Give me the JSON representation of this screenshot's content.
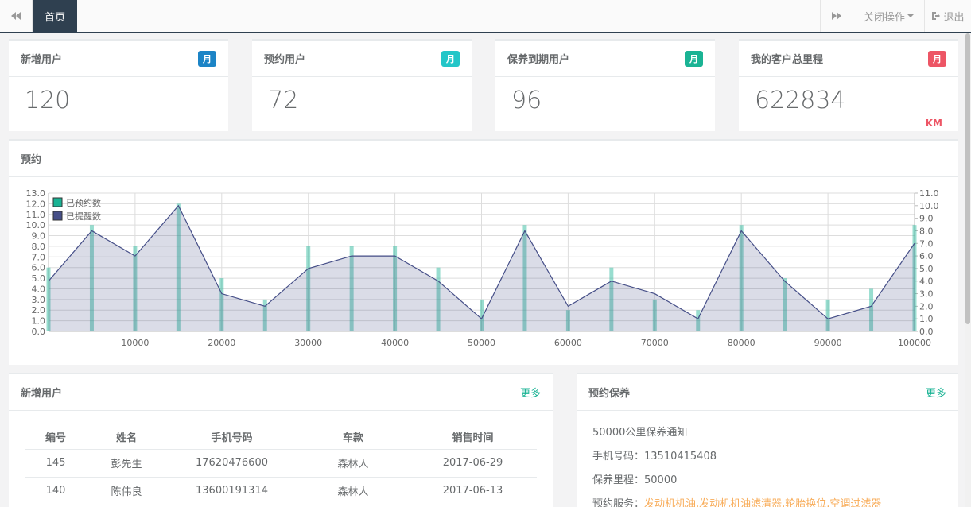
{
  "topbar": {
    "home_tab": "首页",
    "close_ops": "关闭操作",
    "logout": "退出"
  },
  "stats": [
    {
      "title": "新增用户",
      "badge": "月",
      "badge_color": "#1c84c6",
      "value": "120"
    },
    {
      "title": "预约用户",
      "badge": "月",
      "badge_color": "#23c6c8",
      "value": "72"
    },
    {
      "title": "保养到期用户",
      "badge": "月",
      "badge_color": "#1ab394",
      "value": "96"
    },
    {
      "title": "我的客户总里程",
      "badge": "月",
      "badge_color": "#ed5565",
      "value": "622834",
      "unit": "KM"
    }
  ],
  "booking_panel": {
    "title": "预约"
  },
  "chart_data": {
    "type": "bar",
    "x_ticks": [
      10000,
      20000,
      30000,
      40000,
      50000,
      60000,
      70000,
      80000,
      90000,
      100000
    ],
    "x": [
      0,
      5000,
      10000,
      15000,
      20000,
      25000,
      30000,
      35000,
      40000,
      45000,
      50000,
      55000,
      60000,
      65000,
      70000,
      75000,
      80000,
      85000,
      90000,
      95000,
      100000
    ],
    "xlim": [
      0,
      100000
    ],
    "series": [
      {
        "name": "已预约数",
        "type": "bar",
        "axis": "left",
        "color": "#1ab394",
        "values": [
          6,
          10,
          8,
          12,
          5,
          3,
          8,
          8,
          8,
          6,
          3,
          10,
          2,
          6,
          3,
          2,
          10,
          5,
          3,
          4,
          10
        ]
      },
      {
        "name": "已提醒数",
        "type": "area",
        "axis": "right",
        "color": "#464f88",
        "values": [
          4,
          8,
          6,
          10,
          3,
          2,
          5,
          6,
          6,
          4,
          1,
          8,
          2,
          4,
          3,
          1,
          8,
          4,
          1,
          2,
          7
        ]
      }
    ],
    "y_left": {
      "min": 0,
      "max": 13,
      "ticks": [
        "0.0",
        "1.0",
        "2.0",
        "3.0",
        "4.0",
        "5.0",
        "6.0",
        "7.0",
        "8.0",
        "9.0",
        "10.0",
        "11.0",
        "12.0",
        "13.0"
      ]
    },
    "y_right": {
      "min": 0,
      "max": 11,
      "ticks": [
        "0.0",
        "1.0",
        "2.0",
        "3.0",
        "4.0",
        "5.0",
        "6.0",
        "7.0",
        "8.0",
        "9.0",
        "10.0",
        "11.0"
      ]
    },
    "legend_position": "top-left",
    "grid": true
  },
  "new_users_panel": {
    "title": "新增用户",
    "more": "更多",
    "columns": [
      "编号",
      "姓名",
      "手机号码",
      "车款",
      "销售时间"
    ],
    "rows": [
      [
        "145",
        "彭先生",
        "17620476600",
        "森林人",
        "2017-06-29"
      ],
      [
        "140",
        "陈伟良",
        "13600191314",
        "森林人",
        "2017-06-13"
      ]
    ]
  },
  "maintenance_panel": {
    "title": "预约保养",
    "more": "更多",
    "notice_title": "50000公里保养通知",
    "phone": "手机号码：13510415408",
    "mileage": "保养里程：50000",
    "service_label": "预约服务：",
    "service_items": "发动机机油,发动机机油滤清器,轮胎换位,空调过滤器"
  }
}
